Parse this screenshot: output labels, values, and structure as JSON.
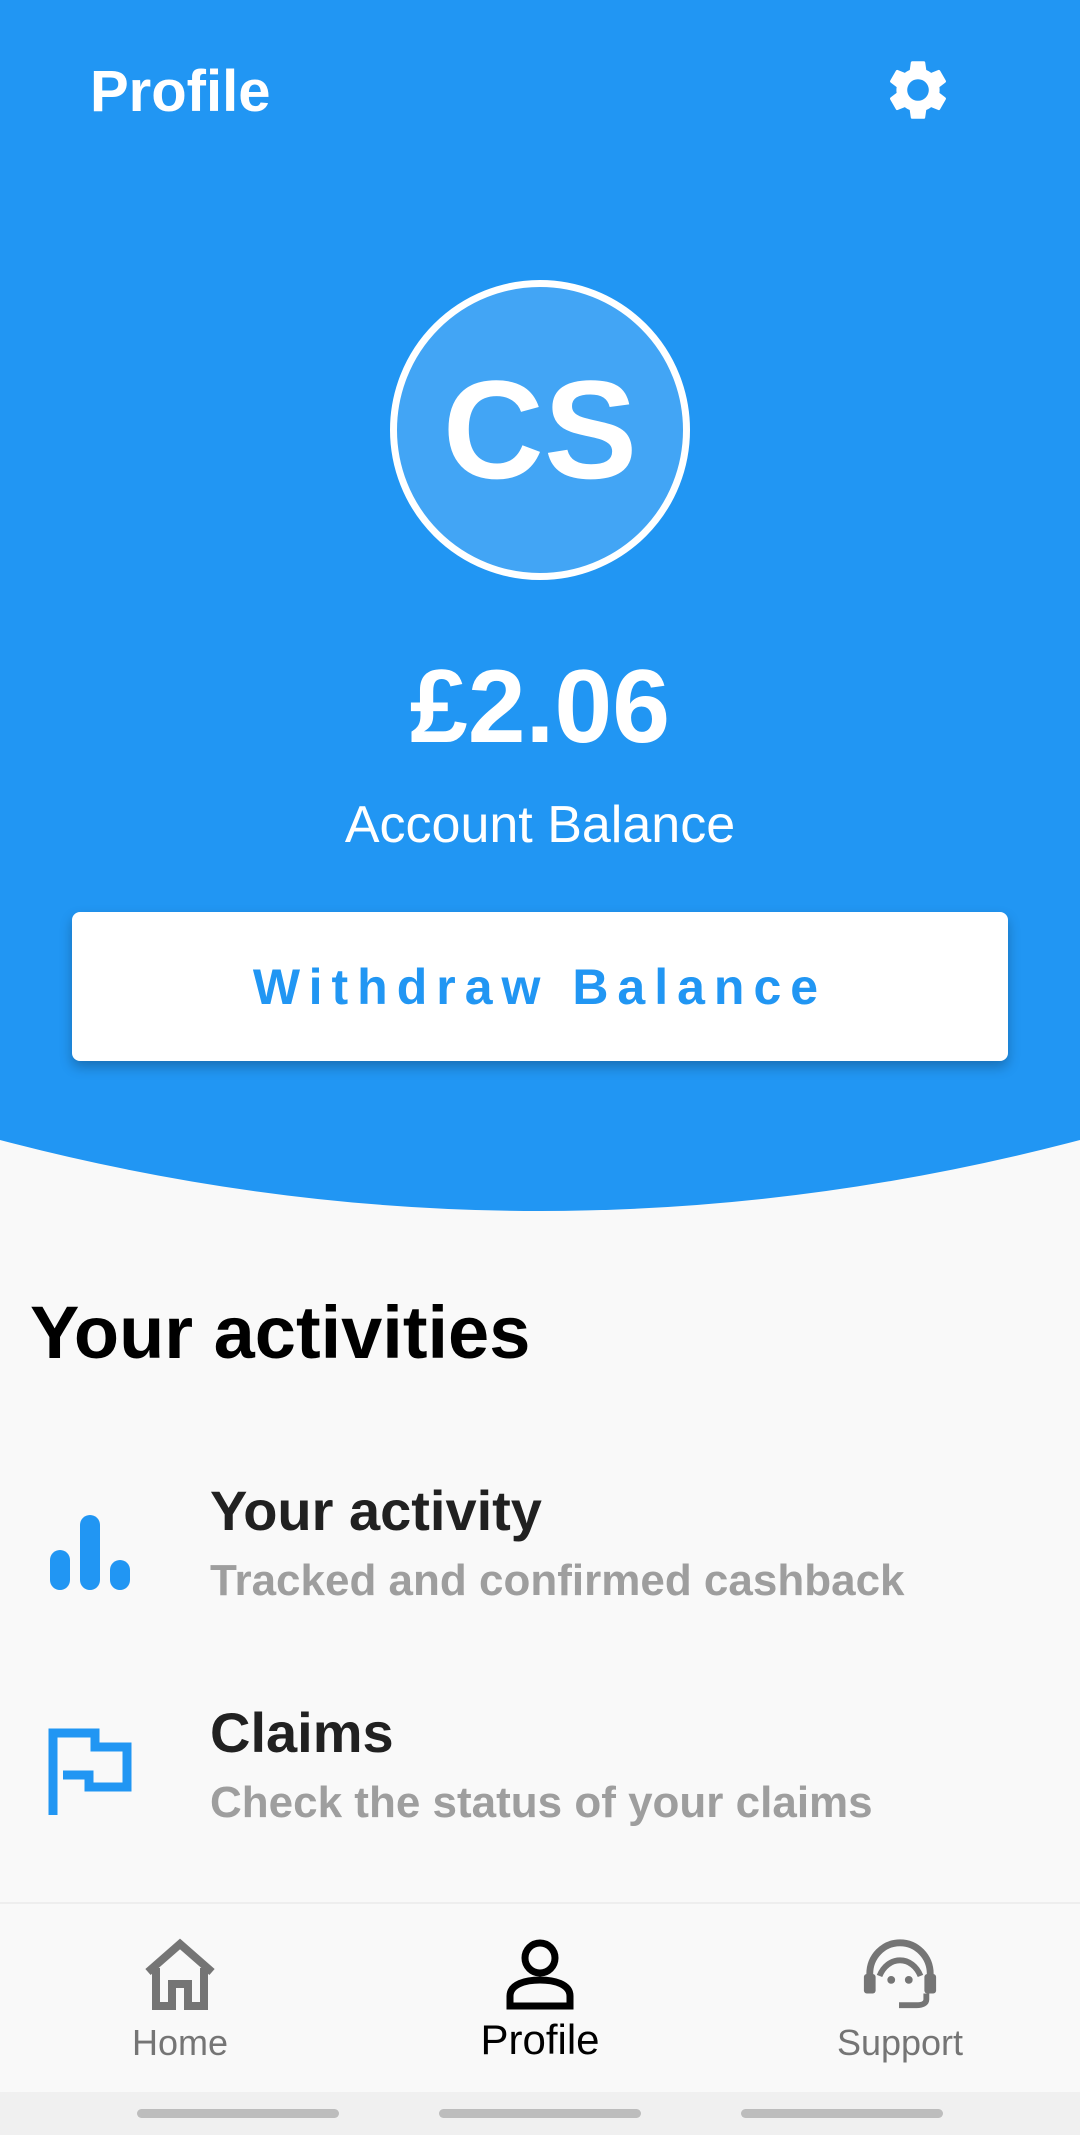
{
  "header": {
    "title": "Profile",
    "settings_icon": "gear-icon",
    "accent_color": "#2196F3"
  },
  "profile": {
    "initials": "CS",
    "balance": "£2.06",
    "balance_label": "Account Balance",
    "withdraw_label": "Withdraw Balance"
  },
  "activities": {
    "section_title": "Your activities",
    "items": [
      {
        "icon": "bar-chart-icon",
        "title": "Your activity",
        "subtitle": "Tracked and confirmed cashback"
      },
      {
        "icon": "flag-icon",
        "title": "Claims",
        "subtitle": "Check the status of your claims"
      }
    ]
  },
  "bottom_nav": {
    "items": [
      {
        "icon": "home-icon",
        "label": "Home"
      },
      {
        "icon": "person-icon",
        "label": "Profile",
        "active": true
      },
      {
        "icon": "support-agent-icon",
        "label": "Support"
      }
    ]
  }
}
